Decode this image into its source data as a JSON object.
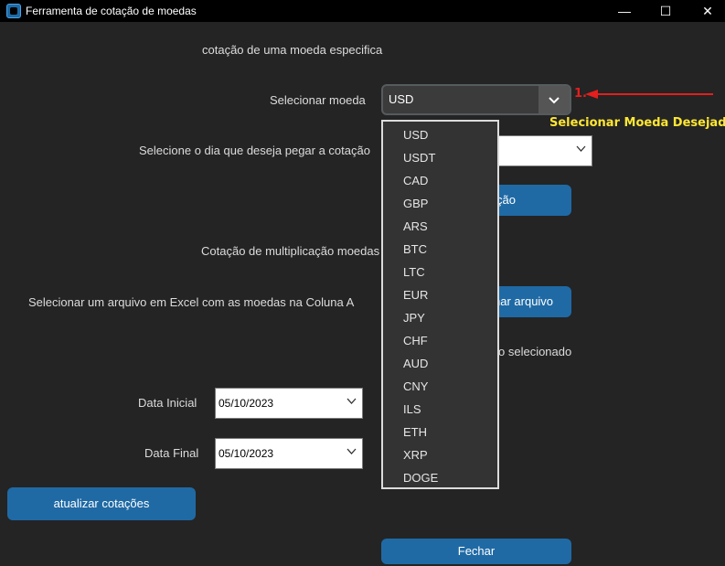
{
  "window": {
    "title": "Ferramenta de cotação de moedas",
    "controls": {
      "minimize": "—",
      "maximize": "☐",
      "close": "✕"
    }
  },
  "main": {
    "heading_specific": "cotação de uma moeda especifica",
    "select_currency_label": "Selecionar moeda",
    "currency_selected": "USD",
    "select_day_label": "Selecione o dia que deseja pegar a cotação",
    "get_quote_button_partial": "ção",
    "multiplication_heading": "Cotação de multiplicação moedas",
    "select_excel_label": "Selecionar um arquivo em Excel com as moedas na Coluna A",
    "select_file_button_partial": "nar arquivo",
    "file_status_partial": "o selecionado",
    "start_date_label": "Data Inicial",
    "start_date_value": "05/10/2023",
    "end_date_label": "Data Final",
    "end_date_value": "05/10/2023",
    "update_button": "atualizar cotações",
    "close_button": "Fechar"
  },
  "dropdown": {
    "options": [
      "USD",
      "USDT",
      "CAD",
      "GBP",
      "ARS",
      "BTC",
      "LTC",
      "EUR",
      "JPY",
      "CHF",
      "AUD",
      "CNY",
      "ILS",
      "ETH",
      "XRP",
      "DOGE"
    ]
  },
  "annotation": {
    "number": "1.",
    "text": "Selecionar Moeda Desejada.",
    "arrow_color": "#e51e1e",
    "text_color": "#ffe733"
  },
  "colors": {
    "button": "#1f6aa5",
    "background": "#242424"
  }
}
